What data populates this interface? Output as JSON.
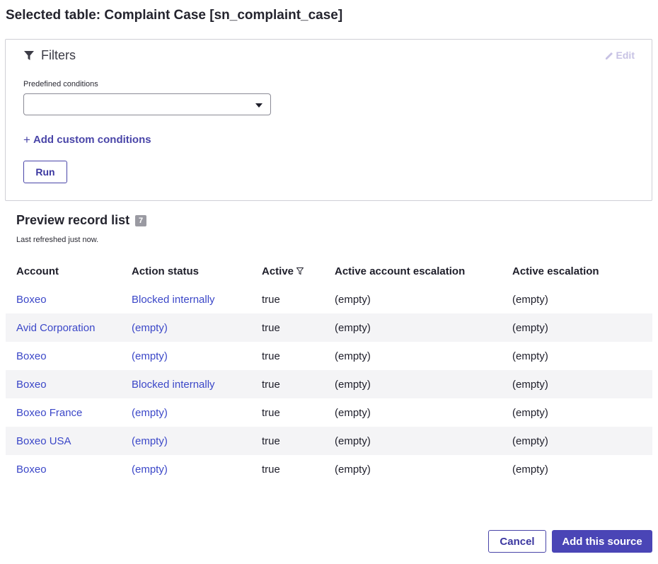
{
  "page": {
    "title": "Selected table: Complaint Case [sn_complaint_case]"
  },
  "filters": {
    "title": "Filters",
    "edit_label": "Edit",
    "predefined_label": "Predefined conditions",
    "predefined_value": "",
    "add_custom_label": "Add custom conditions",
    "run_label": "Run"
  },
  "preview": {
    "title": "Preview record list",
    "count": "7",
    "refreshed": "Last refreshed just now."
  },
  "table": {
    "headers": {
      "account": "Account",
      "action_status": "Action status",
      "active": "Active",
      "active_account_escalation": "Active account escalation",
      "active_escalation": "Active escalation"
    },
    "rows": [
      [
        "Boxeo",
        "Blocked internally",
        "true",
        "(empty)",
        "(empty)"
      ],
      [
        "Avid Corporation",
        "(empty)",
        "true",
        "(empty)",
        "(empty)"
      ],
      [
        "Boxeo",
        "(empty)",
        "true",
        "(empty)",
        "(empty)"
      ],
      [
        "Boxeo",
        "Blocked internally",
        "true",
        "(empty)",
        "(empty)"
      ],
      [
        "Boxeo France",
        "(empty)",
        "true",
        "(empty)",
        "(empty)"
      ],
      [
        "Boxeo USA",
        "(empty)",
        "true",
        "(empty)",
        "(empty)"
      ],
      [
        "Boxeo",
        "(empty)",
        "true",
        "(empty)",
        "(empty)"
      ]
    ]
  },
  "footer": {
    "cancel_label": "Cancel",
    "add_label": "Add this source"
  },
  "colors": {
    "accent": "#4a45b6",
    "link": "#3b47c8",
    "row_alt": "#f4f4f6"
  }
}
